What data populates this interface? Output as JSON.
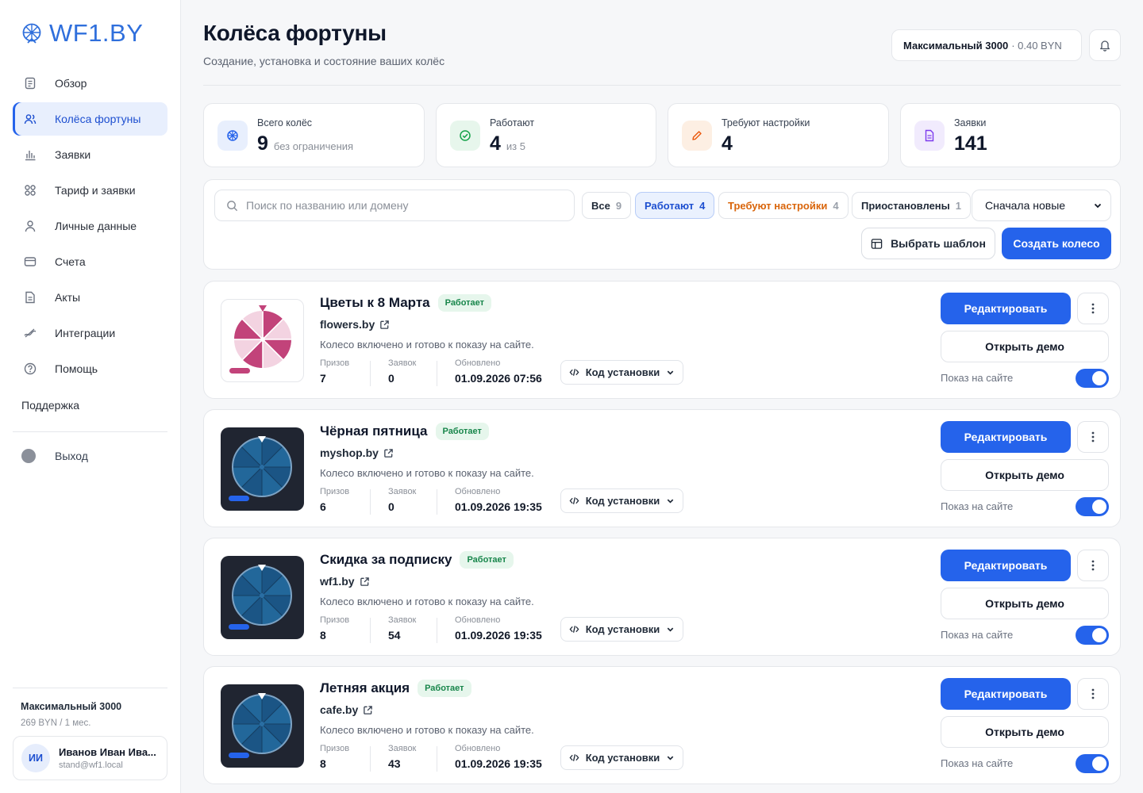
{
  "brand": {
    "name": "WF1.BY",
    "accent": "#2563eb"
  },
  "sidebar": {
    "items": [
      {
        "label": "Обзор",
        "icon": "document-icon",
        "active": false
      },
      {
        "label": "Колёса фортуны",
        "icon": "users-icon",
        "active": true
      },
      {
        "label": "Заявки",
        "icon": "bar-chart-icon",
        "active": false
      },
      {
        "label": "Тариф и заявки",
        "icon": "grid-icon",
        "active": false
      },
      {
        "label": "Личные данные",
        "icon": "user-icon",
        "active": false
      },
      {
        "label": "Счета",
        "icon": "credit-card-icon",
        "active": false
      },
      {
        "label": "Акты",
        "icon": "file-icon",
        "active": false
      },
      {
        "label": "Интеграции",
        "icon": "link-icon",
        "active": false
      },
      {
        "label": "Помощь",
        "icon": "help-icon",
        "active": false
      }
    ],
    "support": "Поддержка",
    "logout": "Выход",
    "plan": {
      "name": "Максимальный 3000",
      "price": "269 BYN / 1 мес."
    },
    "user": {
      "initials": "ИИ",
      "name": "Иванов Иван Ива...",
      "email": "stand@wf1.local"
    }
  },
  "header": {
    "title": "Колёса фортуны",
    "subtitle": "Создание, установка и состояние ваших колёс",
    "plan_chip": {
      "name": "Максимальный 3000",
      "balance": "· 0.40 BYN"
    }
  },
  "stats": [
    {
      "label": "Всего колёс",
      "value": "9",
      "note": "без ограничения",
      "icon": "wheel-icon",
      "color": "#2563eb"
    },
    {
      "label": "Работают",
      "value": "4",
      "note": "из 5",
      "icon": "check-circle-icon",
      "color": "#16a34a"
    },
    {
      "label": "Требуют настройки",
      "value": "4",
      "note": "",
      "icon": "pencil-icon",
      "color": "#ea580c"
    },
    {
      "label": "Заявки",
      "value": "141",
      "note": "",
      "icon": "file-text-icon",
      "color": "#7c3aed"
    }
  ],
  "filters": {
    "search_placeholder": "Поиск по названию или домену",
    "chips": [
      {
        "label": "Все",
        "count": "9",
        "style": "default"
      },
      {
        "label": "Работают",
        "count": "4",
        "style": "selected"
      },
      {
        "label": "Требуют настройки",
        "count": "4",
        "style": "warning"
      },
      {
        "label": "Приостановлены",
        "count": "1",
        "style": "default"
      }
    ],
    "sort": "Сначала новые",
    "template_btn": "Выбрать шаблон",
    "create_btn": "Создать колесо"
  },
  "card_labels": {
    "edit": "Редактировать",
    "demo": "Открыть демо",
    "show": "Показ на сайте",
    "code": "Код установки",
    "prizes": "Призов",
    "requests": "Заявок",
    "updated": "Обновлено",
    "status": "Работает",
    "description": "Колесо включено и готово к показу на сайте."
  },
  "wheels": [
    {
      "title": "Цветы к 8 Марта",
      "domain": "flowers.by",
      "prizes": "7",
      "requests": "0",
      "updated": "01.09.2026 07:56",
      "theme": "light",
      "color": "#c2437a",
      "enabled": true
    },
    {
      "title": "Чёрная пятница",
      "domain": "myshop.by",
      "prizes": "6",
      "requests": "0",
      "updated": "01.09.2026 19:35",
      "theme": "dark",
      "color": "#22679a",
      "enabled": true
    },
    {
      "title": "Скидка за подписку",
      "domain": "wf1.by",
      "prizes": "8",
      "requests": "54",
      "updated": "01.09.2026 19:35",
      "theme": "dark",
      "color": "#22679a",
      "enabled": true
    },
    {
      "title": "Летняя акция",
      "domain": "cafe.by",
      "prizes": "8",
      "requests": "43",
      "updated": "01.09.2026 19:35",
      "theme": "dark",
      "color": "#22679a",
      "enabled": true
    }
  ]
}
